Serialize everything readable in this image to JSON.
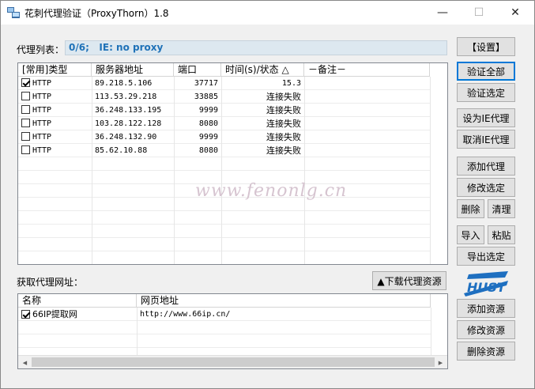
{
  "window": {
    "title": "花刺代理验证（ProxyThorn）1.8",
    "controls": {
      "minimize": "—",
      "maximize": "☐",
      "close": "✕"
    }
  },
  "proxy_panel": {
    "label": "代理列表：",
    "status": "0/6;   IE: no proxy",
    "columns": [
      "[常用]类型",
      "服务器地址",
      "端口",
      "时间(s)/状态 △",
      "－备注－"
    ],
    "rows": [
      {
        "checked": true,
        "type": "HTTP",
        "address": "89.218.5.106",
        "port": "37717",
        "status": "15.3",
        "note": ""
      },
      {
        "checked": false,
        "type": "HTTP",
        "address": "113.53.29.218",
        "port": "33885",
        "status": "连接失败",
        "note": ""
      },
      {
        "checked": false,
        "type": "HTTP",
        "address": "36.248.133.195",
        "port": "9999",
        "status": "连接失败",
        "note": ""
      },
      {
        "checked": false,
        "type": "HTTP",
        "address": "103.28.122.128",
        "port": "8080",
        "status": "连接失败",
        "note": ""
      },
      {
        "checked": false,
        "type": "HTTP",
        "address": "36.248.132.90",
        "port": "9999",
        "status": "连接失败",
        "note": ""
      },
      {
        "checked": false,
        "type": "HTTP",
        "address": "85.62.10.88",
        "port": "8080",
        "status": "连接失败",
        "note": ""
      }
    ]
  },
  "source_panel": {
    "label": "获取代理网址：",
    "download_button": "▲下载代理资源",
    "columns": [
      "名称",
      "网页地址"
    ],
    "rows": [
      {
        "checked": true,
        "name": "66IP提取网",
        "url": "http://www.66ip.cn/"
      }
    ]
  },
  "buttons": {
    "settings": "【设置】",
    "verify_all": "验证全部",
    "verify_selected": "验证选定",
    "set_ie_proxy": "设为IE代理",
    "cancel_ie_proxy": "取消IE代理",
    "add_proxy": "添加代理",
    "edit_selected": "修改选定",
    "delete": "删除",
    "clean": "清理",
    "import": "导入",
    "paste": "粘贴",
    "export_selected": "导出选定",
    "add_source": "添加资源",
    "edit_source": "修改资源",
    "delete_source": "删除资源"
  },
  "watermark": "www.fenonlg.cn",
  "colors": {
    "status_text": "#1f72b8",
    "status_bg": "#dde8f0",
    "logo_blue": "#1e6fc0"
  }
}
